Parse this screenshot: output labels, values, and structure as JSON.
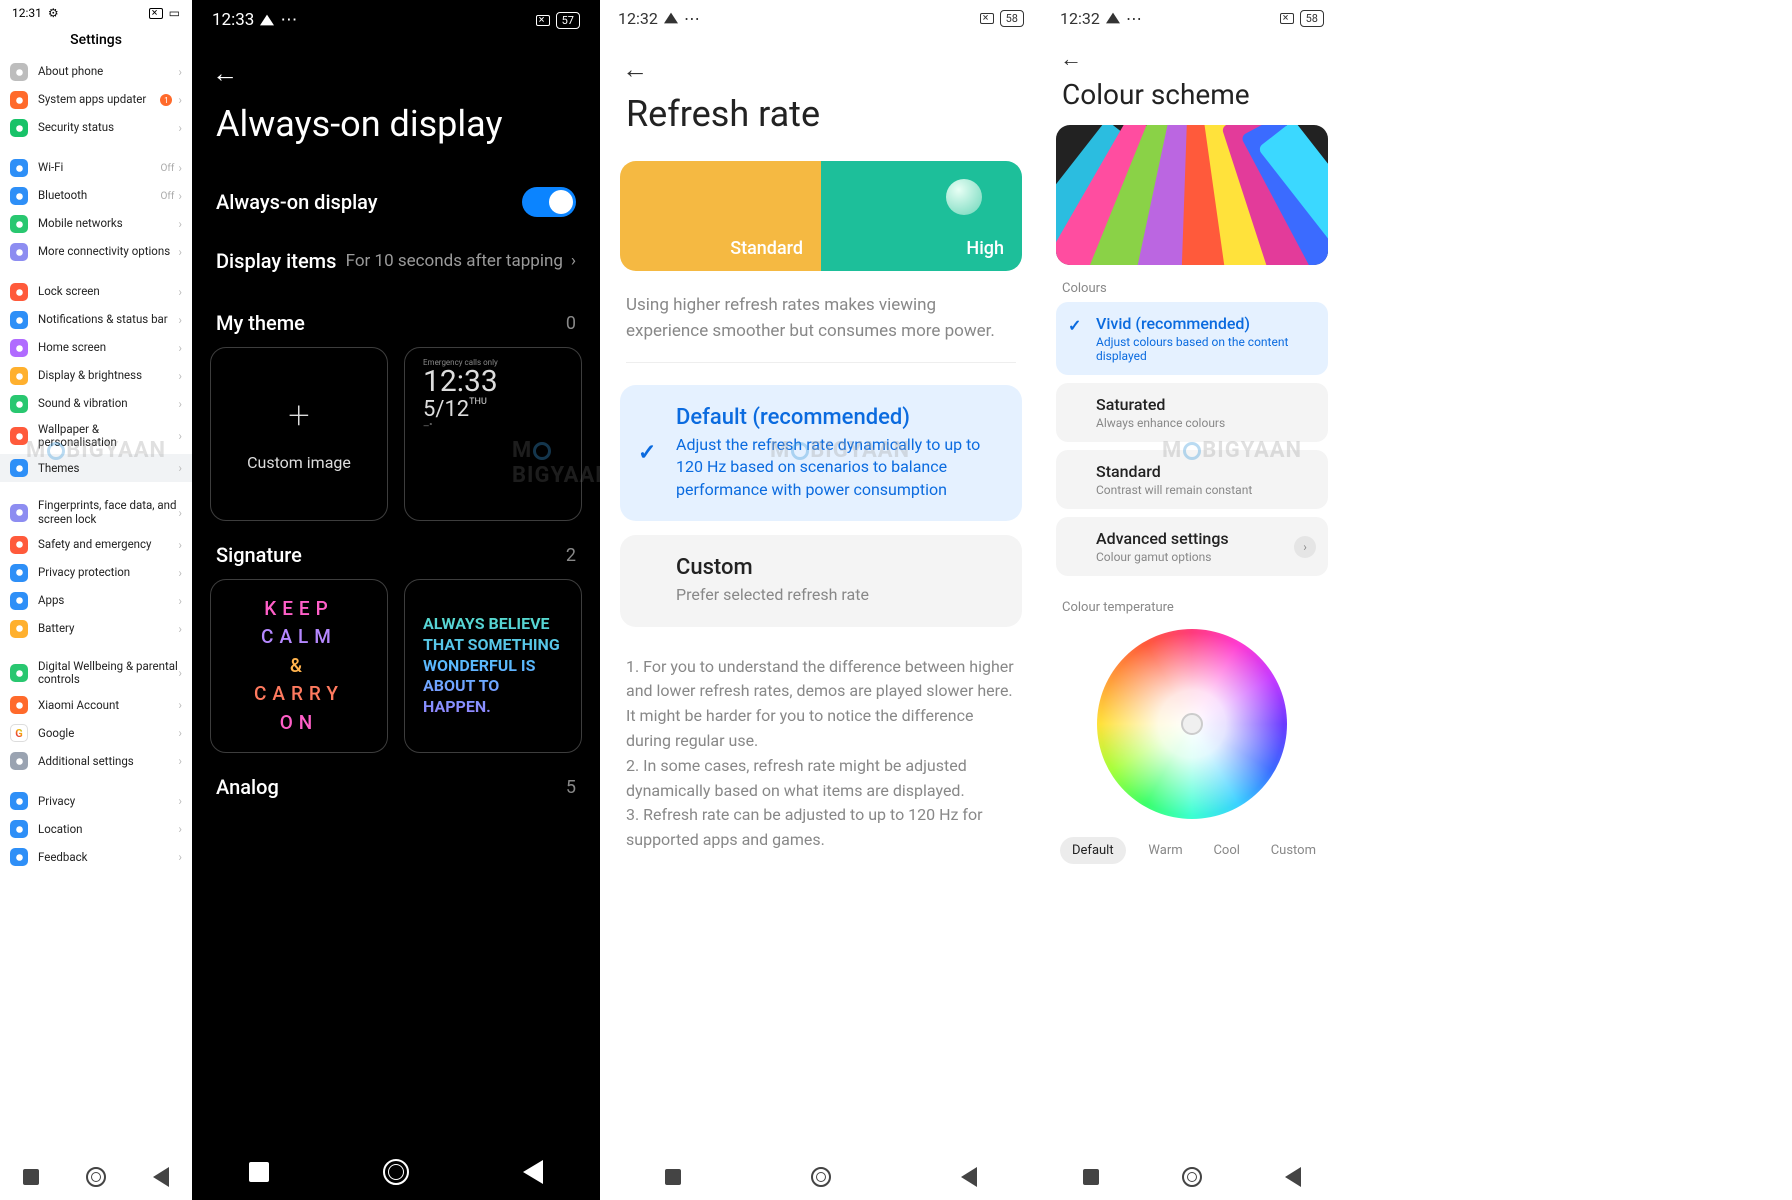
{
  "panel1": {
    "status_time": "12:31",
    "title": "Settings",
    "off": "Off",
    "badge": "1",
    "groups": [
      [
        {
          "icon": "phone",
          "c": "#bdbdbd",
          "label": "About phone"
        },
        {
          "icon": "update",
          "c": "#ff6a2b",
          "label": "System apps updater",
          "badge": true
        },
        {
          "icon": "shield",
          "c": "#17c268",
          "label": "Security status"
        }
      ],
      [
        {
          "icon": "wifi",
          "c": "#2e8ff7",
          "label": "Wi-Fi",
          "sub": "Off"
        },
        {
          "icon": "bt",
          "c": "#2e8ff7",
          "label": "Bluetooth",
          "sub": "Off"
        },
        {
          "icon": "sim",
          "c": "#29c770",
          "label": "Mobile networks"
        },
        {
          "icon": "link",
          "c": "#8d8df1",
          "label": "More connectivity options"
        }
      ],
      [
        {
          "icon": "lock",
          "c": "#ff5a3b",
          "label": "Lock screen"
        },
        {
          "icon": "bell",
          "c": "#2e8ff7",
          "label": "Notifications & status bar"
        },
        {
          "icon": "home",
          "c": "#b06bff",
          "label": "Home screen"
        },
        {
          "icon": "sun",
          "c": "#ffb02e",
          "label": "Display & brightness"
        },
        {
          "icon": "vol",
          "c": "#29c770",
          "label": "Sound & vibration"
        },
        {
          "icon": "wall",
          "c": "#ff5a3b",
          "label": "Wallpaper & personalisation"
        },
        {
          "icon": "theme",
          "c": "#2e8ff7",
          "label": "Themes",
          "active": true
        }
      ],
      [
        {
          "icon": "finger",
          "c": "#8d8df1",
          "label": "Fingerprints, face data, and screen lock"
        },
        {
          "icon": "sos",
          "c": "#ff5a3b",
          "label": "Safety and emergency"
        },
        {
          "icon": "priv",
          "c": "#2e8ff7",
          "label": "Privacy protection"
        },
        {
          "icon": "apps",
          "c": "#2e8ff7",
          "label": "Apps"
        },
        {
          "icon": "batt",
          "c": "#ffb02e",
          "label": "Battery"
        }
      ],
      [
        {
          "icon": "dw",
          "c": "#29c770",
          "label": "Digital Wellbeing & parental controls"
        },
        {
          "icon": "mi",
          "c": "#ff6a2b",
          "label": "Xiaomi Account"
        },
        {
          "icon": "g",
          "c": "#ffffff",
          "label": "Google",
          "g": true
        },
        {
          "icon": "gear",
          "c": "#9aa3b1",
          "label": "Additional settings"
        }
      ],
      [
        {
          "icon": "hand",
          "c": "#2e8ff7",
          "label": "Privacy"
        },
        {
          "icon": "loc",
          "c": "#2e8ff7",
          "label": "Location"
        },
        {
          "icon": "fb",
          "c": "#2e8ff7",
          "label": "Feedback"
        }
      ]
    ]
  },
  "panel2": {
    "status_time": "12:33",
    "battery": "57",
    "title": "Always-on display",
    "toggle_label": "Always-on display",
    "display_items_label": "Display items",
    "display_items_value": "For 10 seconds after tapping",
    "my_theme_label": "My theme",
    "my_theme_count": "0",
    "custom_image": "Custom image",
    "clock_emergency": "Emergency calls only",
    "clock_time": "12:33",
    "clock_date": "5/12",
    "clock_day": "THU",
    "clock_temp": "—°",
    "signature_label": "Signature",
    "signature_count": "2",
    "sig1_l1": "KEEP",
    "sig1_l2": "CALM",
    "sig1_l3": "&",
    "sig1_l4": "CARRY",
    "sig1_l5": "ON",
    "sig2": "ALWAYS BELIEVE THAT SOMETHING WONDERFUL IS ABOUT TO HAPPEN.",
    "analog_label": "Analog",
    "analog_count": "5"
  },
  "panel3": {
    "status_time": "12:32",
    "battery": "58",
    "title": "Refresh rate",
    "standard": "Standard",
    "high": "High",
    "note": "Using higher refresh rates makes viewing experience smoother but consumes more power.",
    "opt1_title": "Default (recommended)",
    "opt1_desc": "Adjust the refresh rate dynamically to up to 120 Hz based on scenarios to balance performance with power consumption",
    "opt2_title": "Custom",
    "opt2_desc": "Prefer selected refresh rate",
    "foot1": "1. For you to understand the difference between higher and lower refresh rates, demos are played slower here. It might be harder for you to notice the difference during regular use.",
    "foot2": "2. In some cases, refresh rate might be adjusted dynamically based on what items are displayed.",
    "foot3": "3. Refresh rate can be adjusted to up to 120 Hz for supported apps and games."
  },
  "panel4": {
    "status_time": "12:32",
    "battery": "58",
    "title": "Colour scheme",
    "colours_label": "Colours",
    "opts": [
      {
        "title": "Vivid (recommended)",
        "desc": "Adjust colours based on the content displayed",
        "sel": true
      },
      {
        "title": "Saturated",
        "desc": "Always enhance colours"
      },
      {
        "title": "Standard",
        "desc": "Contrast will remain constant"
      },
      {
        "title": "Advanced settings",
        "desc": "Colour gamut options",
        "arrow": true
      }
    ],
    "temp_label": "Colour temperature",
    "tabs": [
      "Default",
      "Warm",
      "Cool",
      "Custom"
    ]
  },
  "watermark": "MOBIGYAAN"
}
